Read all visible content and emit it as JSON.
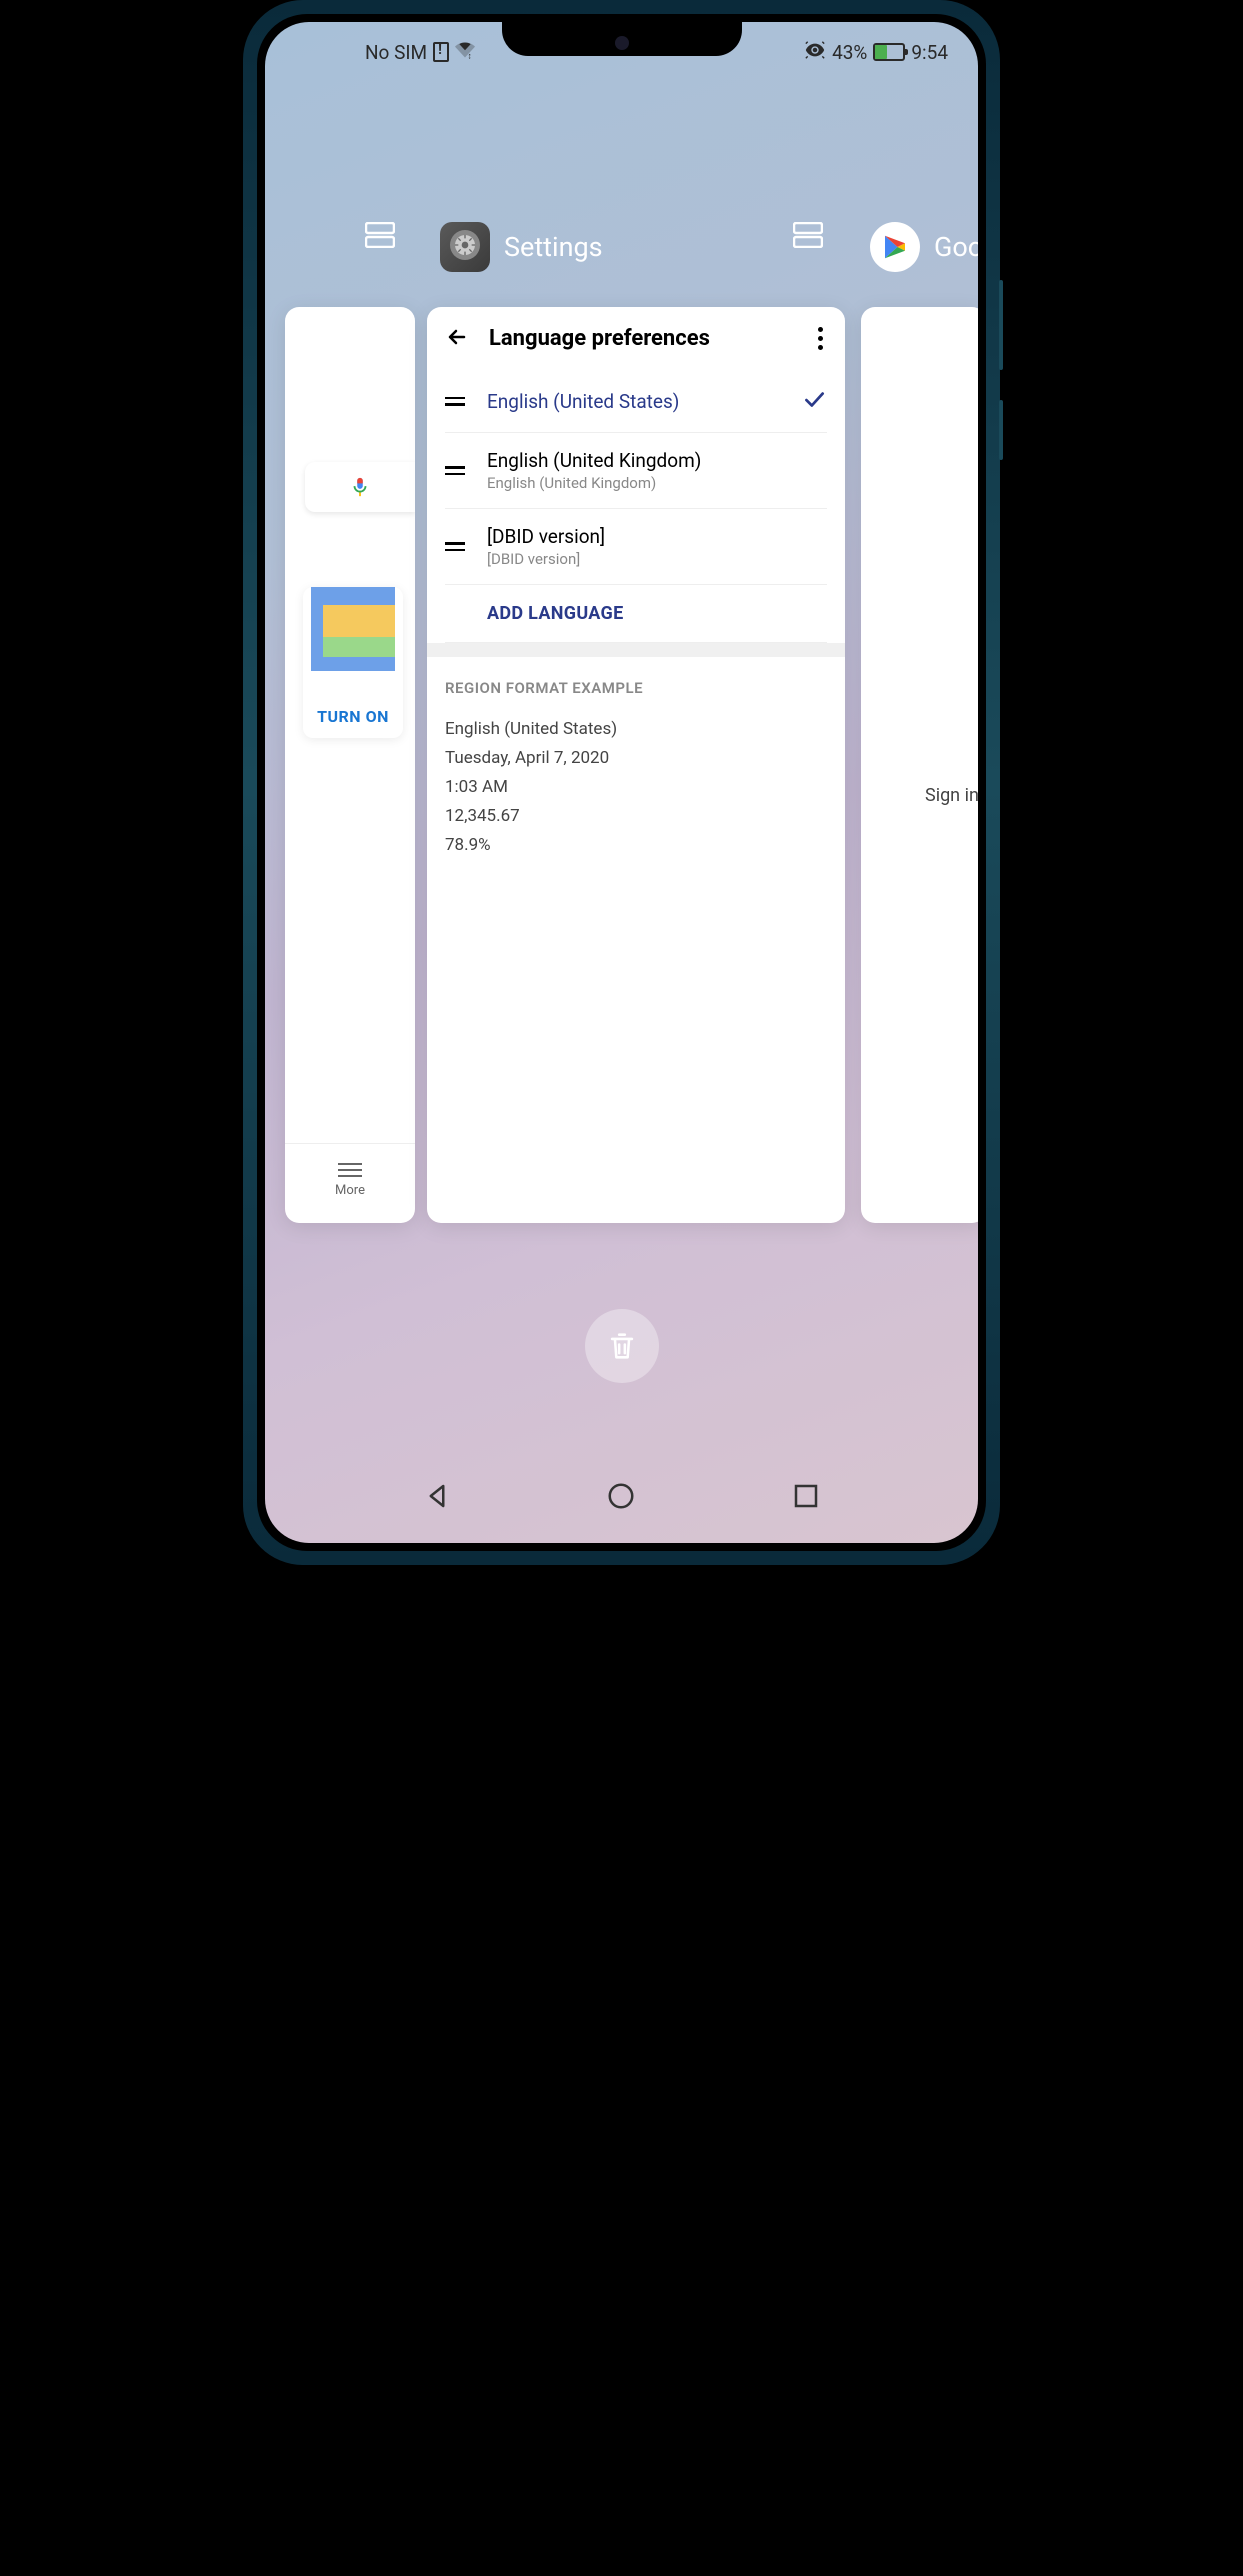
{
  "status": {
    "no_sim": "No SIM",
    "battery_pct": "43%",
    "time": "9:54"
  },
  "recents": {
    "left_app": {
      "turn_on": "TURN ON",
      "more": "More"
    },
    "center_app": {
      "label": "Settings",
      "screen_title": "Language preferences",
      "languages": [
        {
          "primary": "English (United States)",
          "secondary": "",
          "selected": true
        },
        {
          "primary": "English (United Kingdom)",
          "secondary": "English (United Kingdom)",
          "selected": false
        },
        {
          "primary": "[DBID version]",
          "secondary": "[DBID version]",
          "selected": false
        }
      ],
      "add_language": "ADD LANGUAGE",
      "region_header": "REGION FORMAT EXAMPLE",
      "region_example": {
        "locale": "English (United States)",
        "date": "Tuesday, April 7, 2020",
        "time": "1:03 AM",
        "number": "12,345.67",
        "percent": "78.9%"
      }
    },
    "right_app": {
      "label": "Goo",
      "sign_in": "Sign in to"
    }
  }
}
